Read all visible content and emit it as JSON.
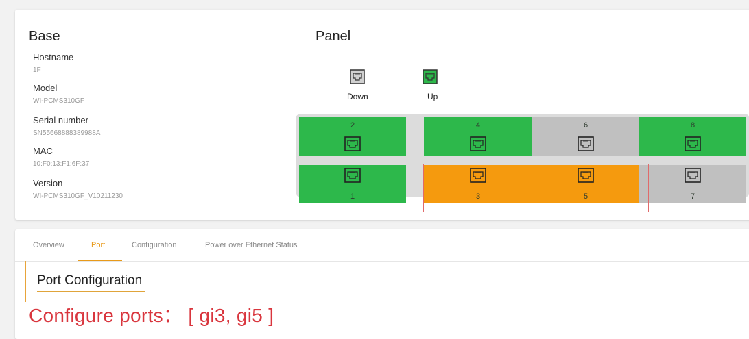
{
  "base": {
    "title": "Base",
    "fields": [
      {
        "label": "Hostname",
        "value": "1F"
      },
      {
        "label": "Model",
        "value": "WI-PCMS310GF"
      },
      {
        "label": "Serial number",
        "value": "SN55668888389988A"
      },
      {
        "label": "MAC",
        "value": "10:F0:13:F1:6F:37"
      },
      {
        "label": "Version",
        "value": "WI-PCMS310GF_V10211230"
      }
    ]
  },
  "panel": {
    "title": "Panel",
    "legend": [
      {
        "label": "Down",
        "color": "#d0d0d0",
        "icon": "ethernet-port-icon"
      },
      {
        "label": "Up",
        "color": "#2db84b",
        "icon": "ethernet-port-icon"
      }
    ],
    "ports_top": [
      {
        "number": "2",
        "status": "up",
        "color": "#2db84b"
      },
      {
        "number": "4",
        "status": "up",
        "color": "#2db84b"
      },
      {
        "number": "6",
        "status": "down",
        "color": "#c0c0c0"
      },
      {
        "number": "8",
        "status": "up",
        "color": "#2db84b"
      }
    ],
    "ports_bottom": [
      {
        "number": "1",
        "status": "up",
        "color": "#2db84b"
      },
      {
        "number": "3",
        "status": "selected",
        "color": "#f59a0e"
      },
      {
        "number": "5",
        "status": "selected",
        "color": "#f59a0e"
      },
      {
        "number": "7",
        "status": "down",
        "color": "#c0c0c0"
      }
    ]
  },
  "tabs": [
    {
      "label": "Overview",
      "active": false
    },
    {
      "label": "Port",
      "active": true
    },
    {
      "label": "Configuration",
      "active": false
    },
    {
      "label": "Power over Ethernet Status",
      "active": false
    }
  ],
  "port_config": {
    "title": "Port Configuration",
    "configure_text": "Configure ports：  [ gi3, gi5 ]"
  },
  "colors": {
    "accent": "#e89a1a",
    "up": "#2db84b",
    "selected": "#f59a0e",
    "down": "#c0c0c0",
    "alert": "#d9363e"
  }
}
